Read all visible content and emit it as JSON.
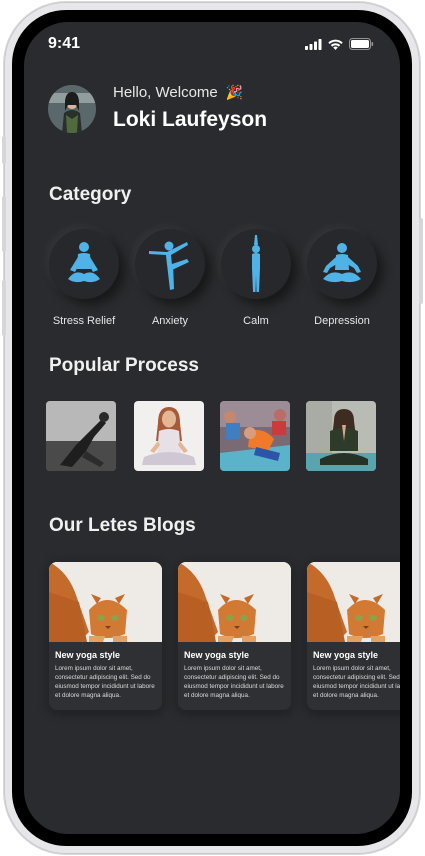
{
  "status_bar": {
    "time": "9:41"
  },
  "header": {
    "greeting": "Hello, Welcome",
    "greeting_emoji": "🎉",
    "user_name": "Loki Laufeyson"
  },
  "category": {
    "title": "Category",
    "items": [
      {
        "label": "Stress Relief",
        "icon": "meditation-pose-icon"
      },
      {
        "label": "Anxiety",
        "icon": "dancer-pose-icon"
      },
      {
        "label": "Calm",
        "icon": "standing-pose-icon"
      },
      {
        "label": "Depression",
        "icon": "lotus-pose-icon"
      }
    ]
  },
  "popular": {
    "title": "Popular Process"
  },
  "blogs": {
    "title": "Our Letes Blogs",
    "cards": [
      {
        "title": "New yoga style",
        "body": "Lorem ipsum dolor sit amet, consectetur adipiscing elit. Sed do eiusmod tempor incididunt ut labore et dolore magna aliqua."
      },
      {
        "title": "New yoga style",
        "body": "Lorem ipsum dolor sit amet, consectetur adipiscing elit. Sed do eiusmod tempor incididunt ut labore et dolore magna aliqua."
      },
      {
        "title": "New yoga style",
        "body": "Lorem ipsum dolor sit amet, consectetur adipiscing elit. Sed do eiusmod tempor incididunt ut labore et dolore magna aliqua."
      }
    ]
  },
  "colors": {
    "background": "#2a2b2e",
    "accent": "#4fb3e8"
  }
}
